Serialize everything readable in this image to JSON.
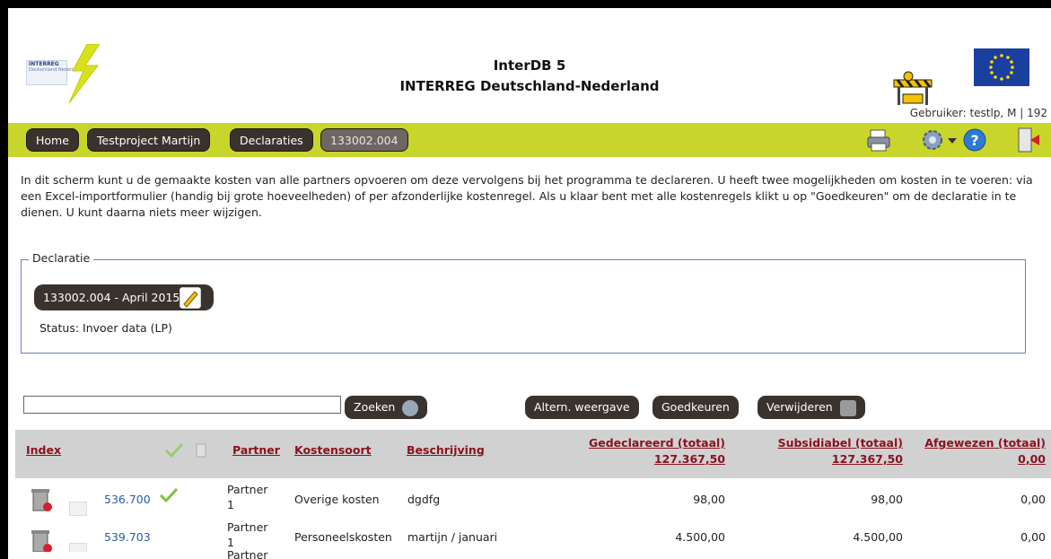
{
  "header": {
    "title_line1": "InterDB 5",
    "title_line2": "INTERREG Deutschland-Nederland",
    "logo_text_top": "INTERREG",
    "logo_text_bottom": "Deutschland Nederland",
    "user_label": "Gebruiker: testlp, M | 192"
  },
  "nav": {
    "crumbs": [
      "Home",
      "Testproject Martijn",
      "Declaraties",
      "133002.004"
    ],
    "icons": [
      "printer-icon",
      "gear-icon",
      "help-icon",
      "logout-icon"
    ]
  },
  "intro": "In dit scherm kunt u de gemaakte kosten van alle partners opvoeren om deze vervolgens bij het programma te declareren. U heeft twee mogelijkheden om kosten in te voeren: via een Excel-importformulier (handig bij grote hoeveelheden) of per afzonderlijke kostenregel. Als u klaar bent met alle kostenregels klikt u op \"Goedkeuren\" om de declaratie in te dienen. U kunt daarna niets meer wijzigen.",
  "declaratie": {
    "legend": "Declaratie",
    "button_label": "133002.004 - April 2015",
    "status": "Status:  Invoer data (LP)"
  },
  "toolbar": {
    "search_value": "",
    "search_label": "Zoeken",
    "altern_label": "Altern. weergave",
    "approve_label": "Goedkeuren",
    "delete_label": "Verwijderen"
  },
  "table": {
    "headers": {
      "index": "Index",
      "partner": "Partner",
      "kostensoort": "Kostensoort",
      "beschrijving": "Beschrijving",
      "gedeclareerd": "Gedeclareerd (totaal)",
      "gedeclareerd_total": "127.367,50",
      "subsidiabel": "Subsidiabel (totaal)",
      "subsidiabel_total": "127.367,50",
      "afgewezen": "Afgewezen (totaal)",
      "afgewezen_total": "0,00"
    },
    "rows": [
      {
        "index": "536.700",
        "partner_1": "Partner",
        "partner_2": "1",
        "kostensoort": "Overige kosten",
        "beschrijving": "dgdfg",
        "gedeclareerd": "98,00",
        "subsidiabel": "98,00",
        "afgewezen": "0,00",
        "approved": true
      },
      {
        "index": "539.703",
        "partner_1": "Partner",
        "partner_2": "1",
        "kostensoort": "Personeelskosten",
        "beschrijving": "martijn / januari",
        "gedeclareerd": "4.500,00",
        "subsidiabel": "4.500,00",
        "afgewezen": "0,00",
        "approved": false
      },
      {
        "index": "",
        "partner_1": "Partner",
        "partner_2": "",
        "kostensoort": "",
        "beschrijving": "",
        "gedeclareerd": "",
        "subsidiabel": "",
        "afgewezen": "",
        "approved": false
      }
    ]
  },
  "colors": {
    "navbar": "#c8d62b",
    "button_dark": "#3a322d",
    "header_link": "#8b1120",
    "index_link": "#2a5ca8",
    "table_header_bg": "#d1d1d1",
    "eu_blue": "#1b3f9e",
    "check_green": "#7cc242"
  }
}
